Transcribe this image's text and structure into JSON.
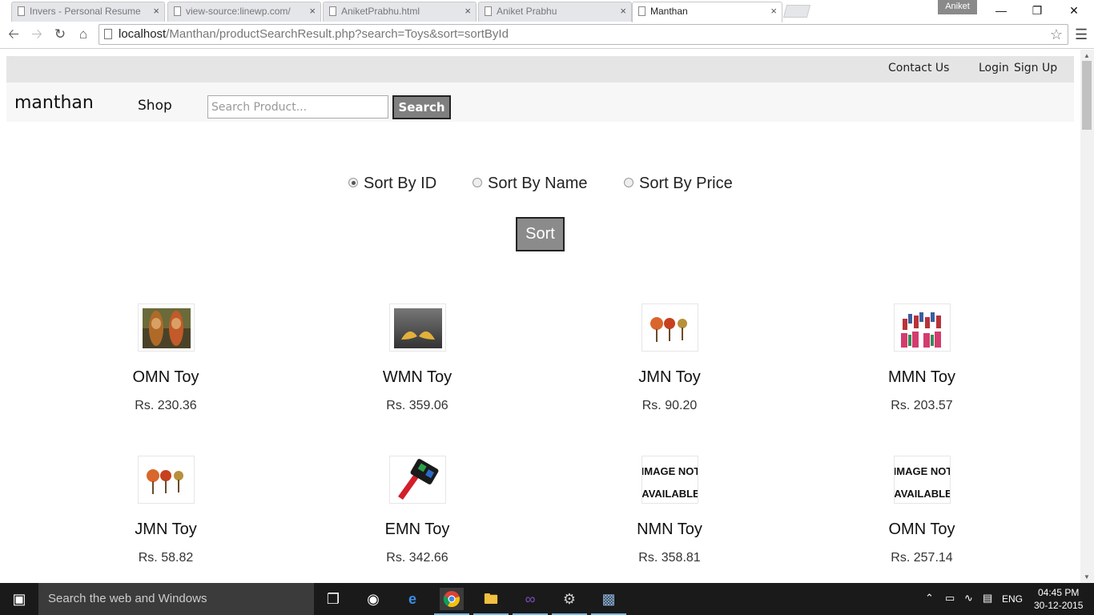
{
  "browser": {
    "tabs": [
      {
        "label": "Invers - Personal Resume"
      },
      {
        "label": "view-source:linewp.com/"
      },
      {
        "label": "AniketPrabhu.html"
      },
      {
        "label": "Aniket Prabhu"
      },
      {
        "label": "Manthan"
      }
    ],
    "user_badge": "Aniket",
    "url_host": "localhost",
    "url_path": "/Manthan/productSearchResult.php?search=Toys&sort=sortById"
  },
  "header": {
    "top_links": [
      "Contact Us",
      "Login",
      "Sign Up"
    ],
    "brand": "manthan",
    "shop": "Shop",
    "search_placeholder": "Search Product...",
    "search_button": "Search"
  },
  "sort": {
    "options": [
      "Sort By ID",
      "Sort By Name",
      "Sort By Price"
    ],
    "selected": "Sort By ID",
    "button": "Sort"
  },
  "products": [
    {
      "name": "OMN Toy",
      "price": "Rs. 230.36",
      "image": "dolls-photo"
    },
    {
      "name": "WMN Toy",
      "price": "Rs. 359.06",
      "image": "birds-photo"
    },
    {
      "name": "JMN Toy",
      "price": "Rs. 90.20",
      "image": "rattles-photo"
    },
    {
      "name": "MMN Toy",
      "price": "Rs. 203.57",
      "image": "puppets-photo"
    },
    {
      "name": "JMN Toy",
      "price": "Rs. 58.82",
      "image": "rattles-photo"
    },
    {
      "name": "EMN Toy",
      "price": "Rs. 342.66",
      "image": "toy-tool-photo"
    },
    {
      "name": "NMN Toy",
      "price": "Rs. 358.81",
      "image": "image-not-available",
      "placeholder_text": [
        "IMAGE NOT",
        "AVAILABLE"
      ]
    },
    {
      "name": "OMN Toy",
      "price": "Rs. 257.14",
      "image": "image-not-available",
      "placeholder_text": [
        "IMAGE NOT",
        "AVAILABLE"
      ]
    }
  ],
  "taskbar": {
    "search_placeholder": "Search the web and Windows",
    "lang": "ENG",
    "time": "04:45 PM",
    "date": "30-12-2015"
  }
}
